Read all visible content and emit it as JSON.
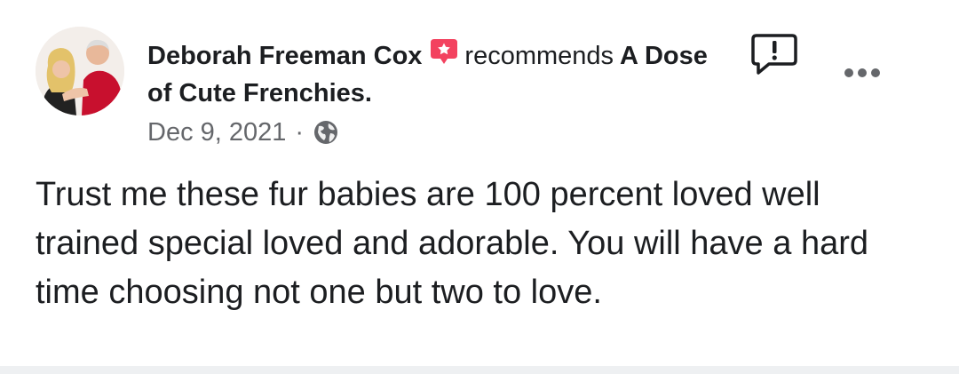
{
  "post": {
    "author_name": "Deborah Freeman Cox",
    "action_text": "recommends",
    "page_name": "A Dose of Cute Frenchies.",
    "date": "Dec 9, 2021",
    "separator": "·",
    "audience_icon": "globe-icon",
    "recommend_badge_icon": "recommend-star-badge-icon",
    "report_icon": "report-flag-icon",
    "more_icon": "more-options-icon",
    "body": "Trust me these fur babies are 100 percent loved well trained special loved and adorable. You will have a hard time choosing not one but two to love."
  },
  "colors": {
    "primary_text": "#1c1e21",
    "secondary_text": "#65676b",
    "badge": "#f3425f",
    "divider": "#eef0f2"
  }
}
